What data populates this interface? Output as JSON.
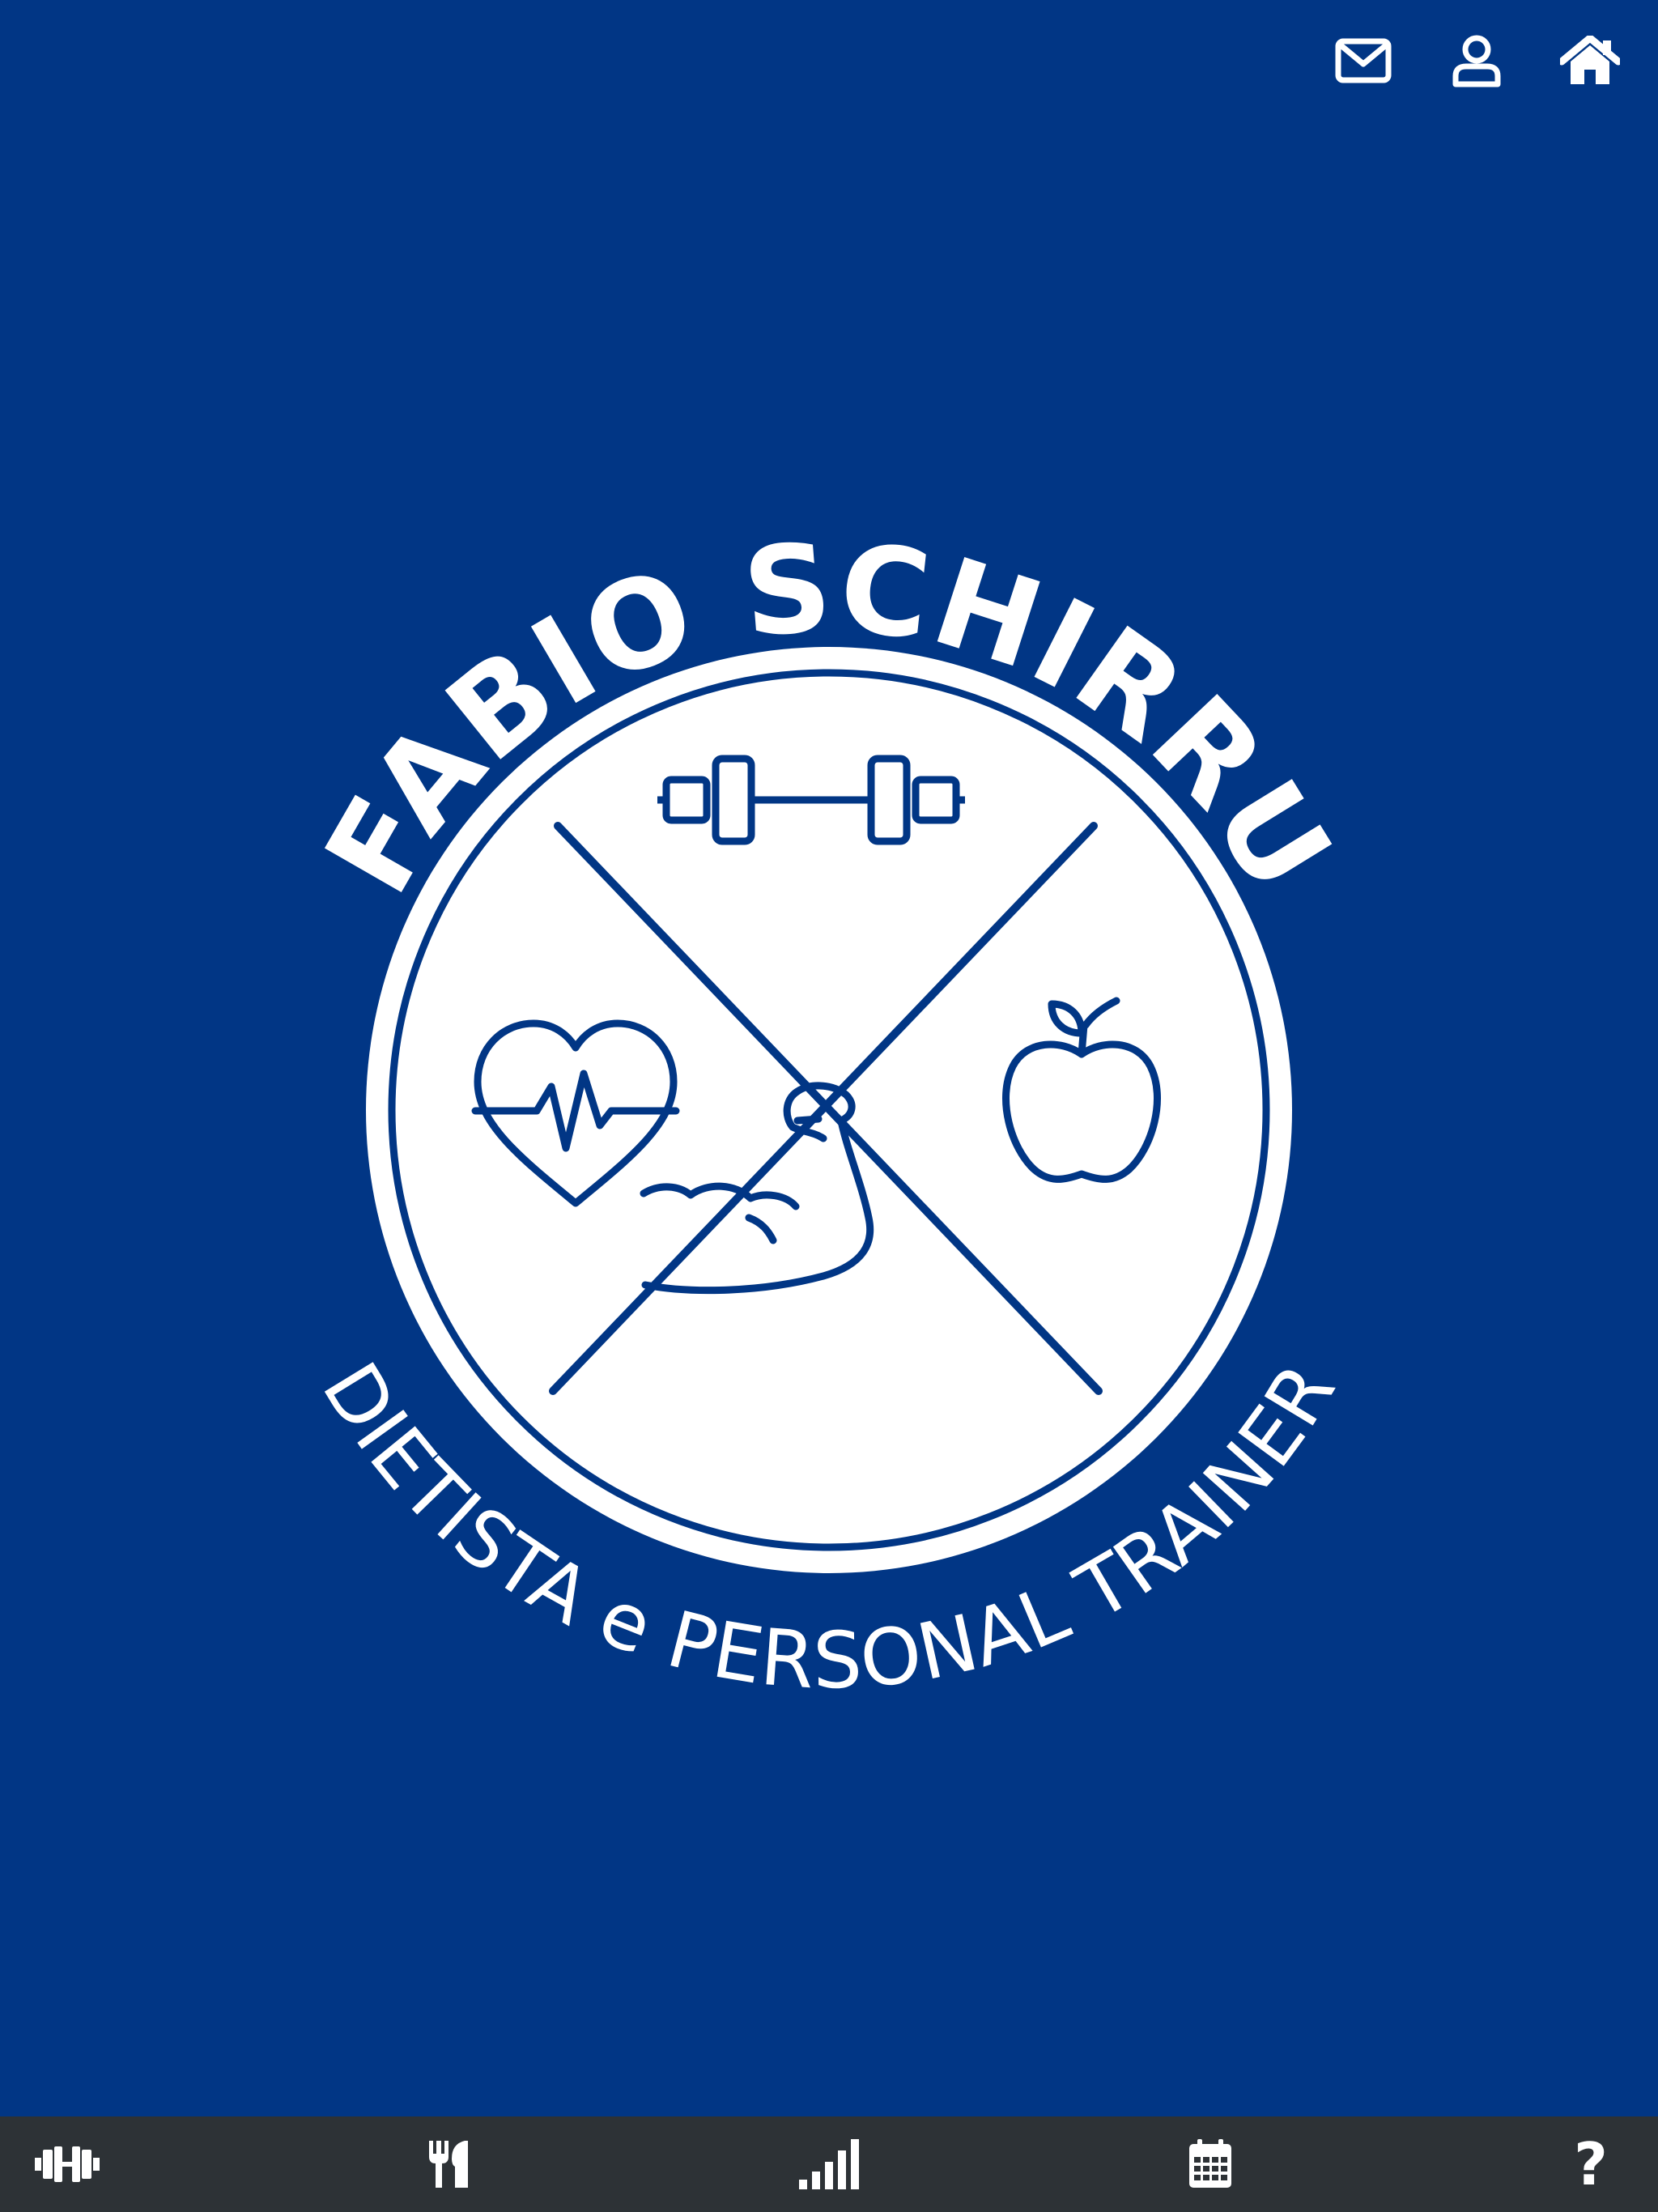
{
  "colors": {
    "background": "#013685",
    "foreground": "#ffffff",
    "bottom_bar": "#2d3236"
  },
  "top_bar": {
    "icons": [
      "mail-icon",
      "user-icon",
      "home-icon"
    ]
  },
  "logo": {
    "name": "FABIO SCHIRRU",
    "tagline": "DIETISTA e PERSONAL TRAINER",
    "emblem_icons": [
      "dumbbell-icon",
      "heartbeat-icon",
      "apple-icon",
      "flexed-arm-icon"
    ]
  },
  "bottom_nav": {
    "icons": [
      "dumbbell-icon",
      "utensils-icon",
      "signal-bars-icon",
      "calendar-icon",
      "question-icon"
    ],
    "help_label": "?"
  }
}
